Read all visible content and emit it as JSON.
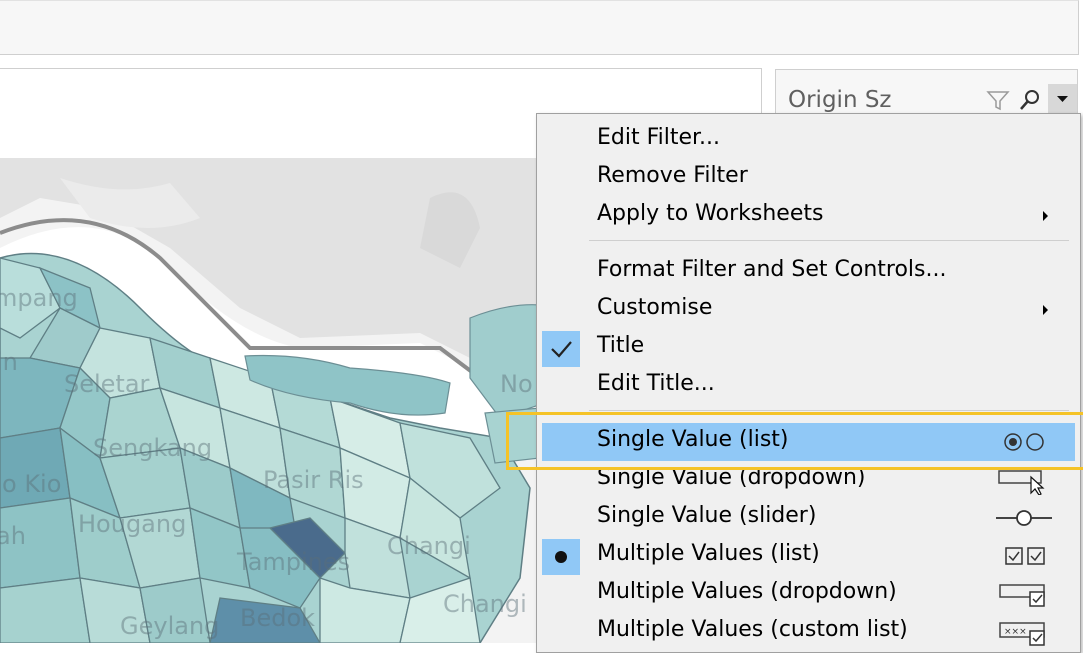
{
  "map": {
    "labels": [
      "mpang",
      "in",
      "Seletar",
      "Sengkang",
      "o Kio",
      "Pasir Ris",
      "Hougang",
      "ah",
      "Changi",
      "Tampines",
      "Changi",
      "Geylang",
      "Bedok",
      "No"
    ]
  },
  "filter_card": {
    "title": "Origin Sz",
    "icons": [
      "funnel-icon",
      "search-icon",
      "chevron-down-icon"
    ]
  },
  "menu": {
    "items": [
      {
        "label": "Edit Filter..."
      },
      {
        "label": "Remove Filter"
      },
      {
        "label": "Apply to Worksheets",
        "submenu": true
      },
      {
        "label": "Format Filter and Set Controls..."
      },
      {
        "label": "Customise",
        "submenu": true
      },
      {
        "label": "Title",
        "checked": true
      },
      {
        "label": "Edit Title..."
      },
      {
        "label": "Single Value (list)",
        "highlighted": true,
        "icon": "radio-list-icon"
      },
      {
        "label": "Single Value (dropdown)",
        "icon": "dropdown-cursor-icon"
      },
      {
        "label": "Single Value (slider)",
        "icon": "slider-icon"
      },
      {
        "label": "Multiple Values (list)",
        "selected": true,
        "icon": "checkbox-list-icon"
      },
      {
        "label": "Multiple Values (dropdown)",
        "icon": "dropdown-checkbox-icon"
      },
      {
        "label": "Multiple Values (custom list)",
        "icon": "custom-list-icon"
      }
    ]
  },
  "colors": {
    "highlight": "#90c8f6",
    "callout_border": "#f5c327",
    "menu_bg": "#f0f0f0",
    "map_dark": "#4a6b8c"
  }
}
